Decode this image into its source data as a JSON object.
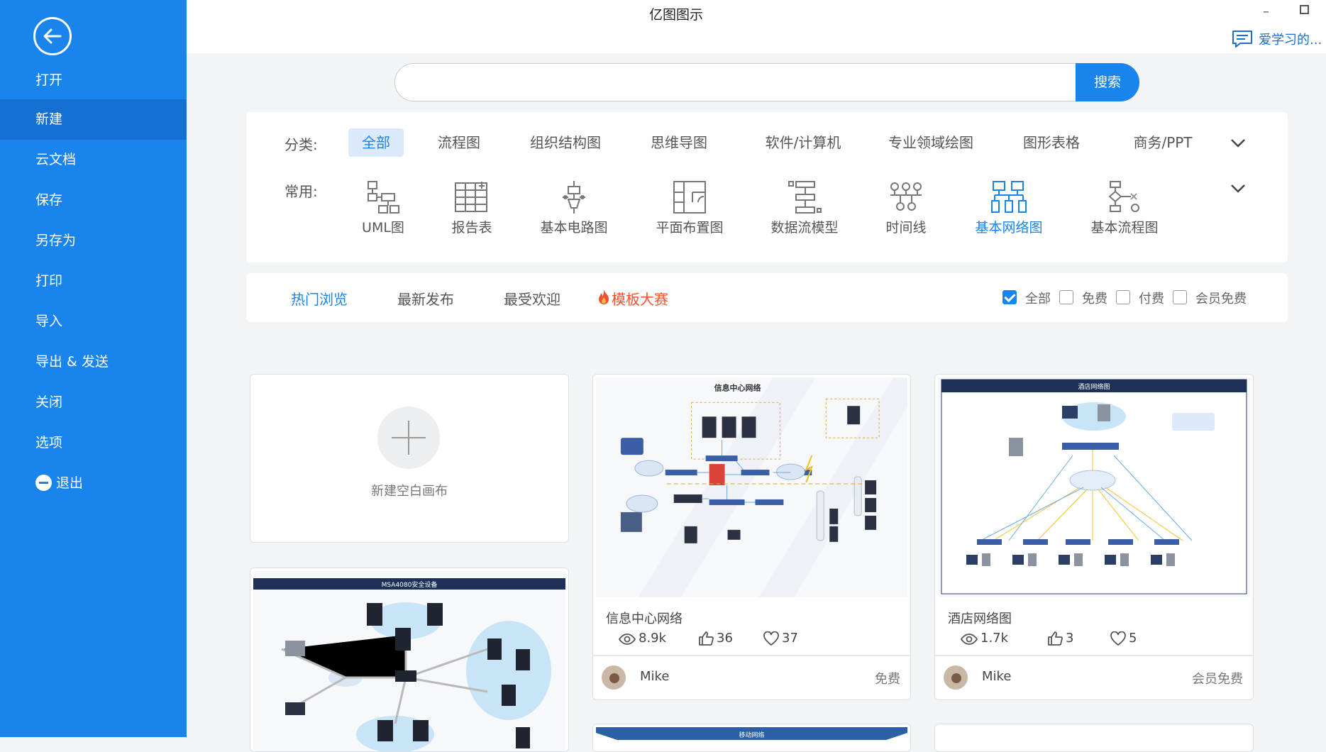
{
  "window": {
    "title": "亿图图示",
    "feedback_label": "爱学习的..."
  },
  "sidebar": {
    "items": [
      {
        "label": "打开"
      },
      {
        "label": "新建"
      },
      {
        "label": "云文档"
      },
      {
        "label": "保存"
      },
      {
        "label": "另存为"
      },
      {
        "label": "打印"
      },
      {
        "label": "导入"
      },
      {
        "label": "导出 & 发送"
      },
      {
        "label": "关闭"
      },
      {
        "label": "选项"
      },
      {
        "label": "退出"
      }
    ],
    "active_index": 1
  },
  "search": {
    "placeholder": "",
    "value": "",
    "button_label": "搜索"
  },
  "categories": {
    "label": "分类:",
    "items": [
      "全部",
      "流程图",
      "组织结构图",
      "思维导图",
      "软件/计算机",
      "专业领域绘图",
      "图形表格",
      "商务/PPT"
    ],
    "active": "全部"
  },
  "common": {
    "label": "常用:",
    "items": [
      {
        "label": "UML图",
        "icon": "uml-icon"
      },
      {
        "label": "报告表",
        "icon": "report-icon"
      },
      {
        "label": "基本电路图",
        "icon": "circuit-icon"
      },
      {
        "label": "平面布置图",
        "icon": "floor-plan-icon"
      },
      {
        "label": "数据流模型",
        "icon": "data-flow-icon"
      },
      {
        "label": "时间线",
        "icon": "timeline-icon"
      },
      {
        "label": "基本网络图",
        "icon": "network-icon"
      },
      {
        "label": "基本流程图",
        "icon": "flowchart-icon"
      }
    ],
    "active": "基本网络图"
  },
  "tabs": {
    "items": [
      "热门浏览",
      "最新发布",
      "最受欢迎",
      "模板大赛"
    ],
    "active": "热门浏览"
  },
  "filters": [
    {
      "label": "全部",
      "checked": true
    },
    {
      "label": "免费",
      "checked": false
    },
    {
      "label": "付费",
      "checked": false
    },
    {
      "label": "会员免费",
      "checked": false
    }
  ],
  "cards": {
    "new_blank_label": "新建空白画布",
    "templates": [
      {
        "thumb_title": "信息中心网络",
        "title": "信息中心网络",
        "views": "8.9k",
        "likes": "36",
        "favorites": "37",
        "author": "Mike",
        "price": "免费"
      },
      {
        "thumb_title": "酒店网络图",
        "title": "酒店网络图",
        "views": "1.7k",
        "likes": "3",
        "favorites": "5",
        "author": "Mike",
        "price": "会员免费"
      },
      {
        "thumb_title": "MSA4080安全设备"
      },
      {
        "thumb_title": "移动网络"
      }
    ]
  },
  "colors": {
    "accent": "#1a84ed",
    "sidebar": "#1a84ed",
    "sidebar_active": "#1470d2",
    "hot": "#f0522d"
  }
}
